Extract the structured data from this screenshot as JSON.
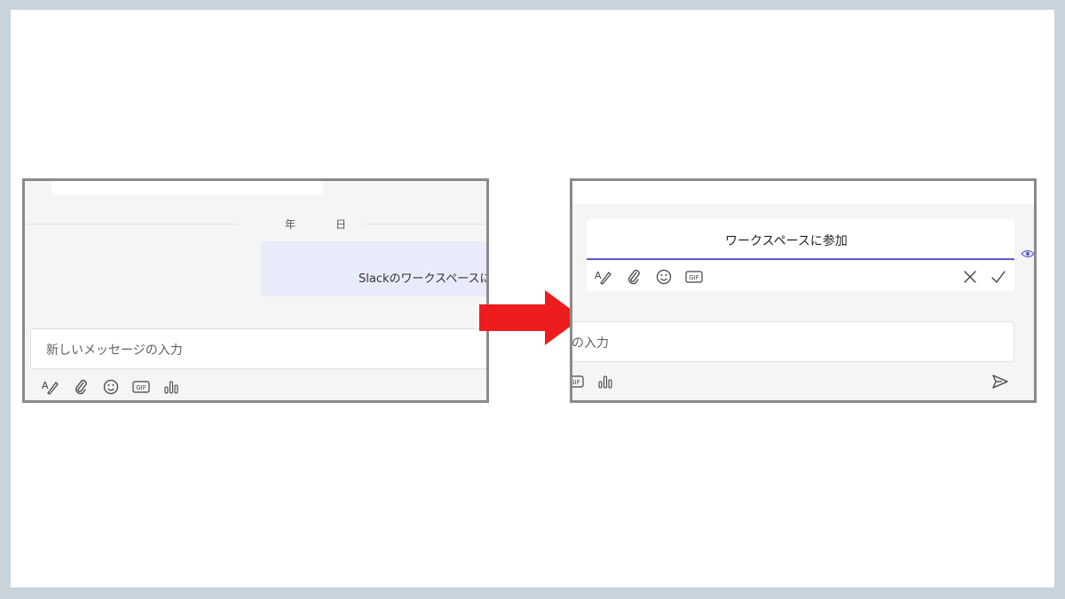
{
  "left": {
    "date_divider": {
      "year": "年",
      "day": "日"
    },
    "message_bubble": {
      "text": "Slackのワークスペースに参"
    },
    "compose": {
      "placeholder": "新しいメッセージの入力"
    },
    "toolbar": {
      "icons": [
        "format-icon",
        "attach-icon",
        "emoji-icon",
        "gif-icon",
        "poll-icon"
      ],
      "gif_label": "GIF"
    }
  },
  "arrow": {
    "color": "#ee1c1c"
  },
  "right": {
    "edit": {
      "value": "ワークスペースに参加",
      "accent": "#5b5fc7",
      "toolbar": {
        "icons": [
          "format-icon",
          "attach-icon",
          "emoji-icon",
          "gif-icon"
        ],
        "gif_label": "GIF"
      },
      "actions": [
        "cancel-icon",
        "confirm-icon"
      ]
    },
    "compose": {
      "placeholder_visible": "の入力",
      "toolbar": {
        "icons": [
          "gif-icon",
          "poll-icon"
        ],
        "gif_label": "GIF"
      },
      "send": "send-icon"
    }
  }
}
